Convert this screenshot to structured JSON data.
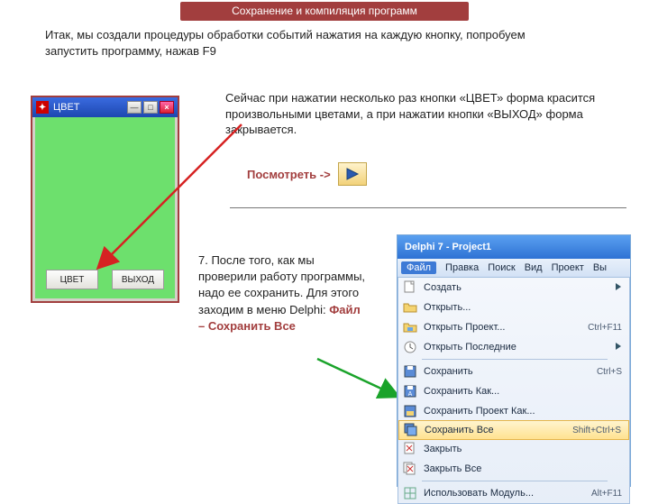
{
  "title": "Сохранение и компиляция программ",
  "intro": "Итак, мы создали процедуры обработки событий нажатия на каждую кнопку, попробуем запустить программу, нажав F9",
  "desc": "Сейчас при нажатии несколько раз кнопки «ЦВЕТ» форма красится произвольными цветами, а при нажатии кнопки «ВЫХОД» форма закрывается.",
  "look_label": "Посмотреть ->",
  "step7_a": "7. После того, как мы проверили работу программы, надо ее сохранить. Для этого заходим в меню Delphi:  ",
  "step7_b": "Файл – Сохранить Все",
  "form": {
    "title": "ЦВЕТ",
    "btn_color": "ЦВЕТ",
    "btn_exit": "ВЫХОД"
  },
  "ide": {
    "title": "Delphi 7 - Project1",
    "menu": [
      "Файл",
      "Правка",
      "Поиск",
      "Вид",
      "Проект",
      "Вы"
    ],
    "items": [
      {
        "icon": "doc-new",
        "label": "Создать",
        "short": "",
        "arrow": true
      },
      {
        "icon": "folder",
        "label": "Открыть...",
        "short": ""
      },
      {
        "icon": "folder-proj",
        "label": "Открыть Проект...",
        "short": "Ctrl+F11"
      },
      {
        "icon": "clock",
        "label": "Открыть Последние",
        "short": "",
        "arrow": true
      },
      {
        "sep": true
      },
      {
        "icon": "disk",
        "label": "Сохранить",
        "short": "Ctrl+S"
      },
      {
        "icon": "disk-as",
        "label": "Сохранить Как...",
        "short": ""
      },
      {
        "icon": "disk-proj",
        "label": "Сохранить Проект Как...",
        "short": ""
      },
      {
        "icon": "disks",
        "label": "Сохранить Все",
        "short": "Shift+Ctrl+S",
        "sel": true
      },
      {
        "icon": "doc-x",
        "label": "Закрыть",
        "short": ""
      },
      {
        "icon": "docs-x",
        "label": "Закрыть Все",
        "short": ""
      },
      {
        "sep": true
      },
      {
        "icon": "unit",
        "label": "Использовать Модуль...",
        "short": "Alt+F11"
      }
    ]
  }
}
